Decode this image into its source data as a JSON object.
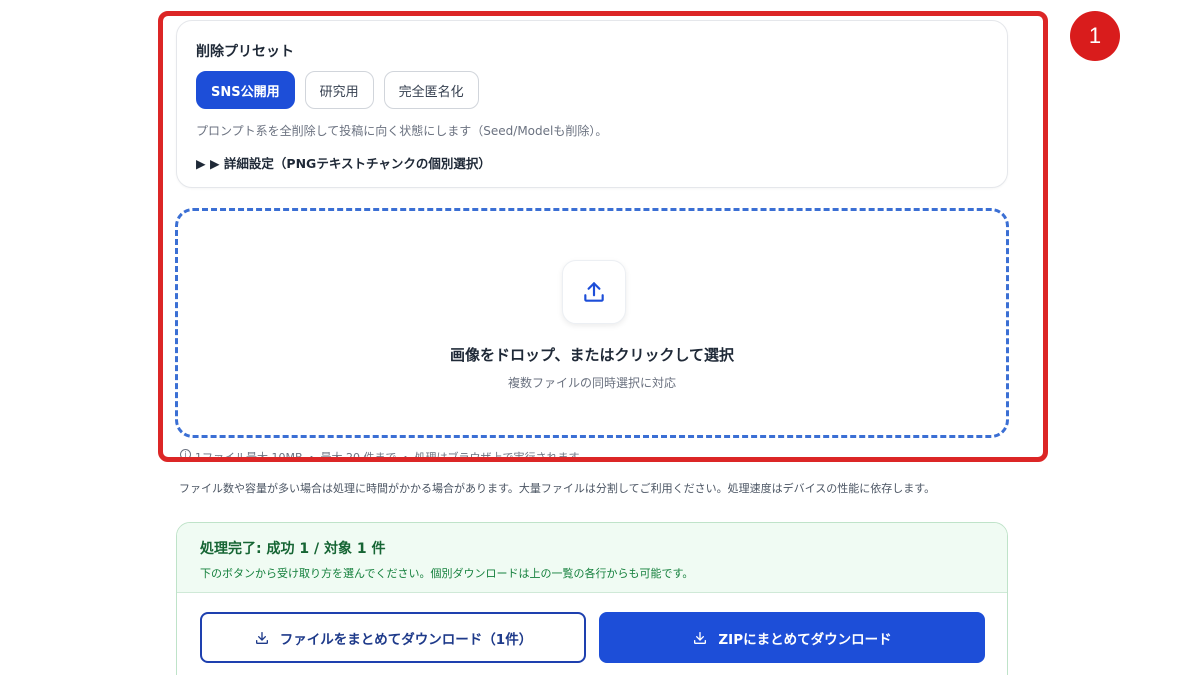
{
  "preset": {
    "title": "削除プリセット",
    "buttons": [
      {
        "label": "SNS公開用",
        "active": true
      },
      {
        "label": "研究用",
        "active": false
      },
      {
        "label": "完全匿名化",
        "active": false
      }
    ],
    "description": "プロンプト系を全削除して投稿に向く状態にします（Seed/Modelも削除）。",
    "detail_toggle": "▶ ▶ 詳細設定（PNGテキストチャンクの個別選択）"
  },
  "dropzone": {
    "icon": "upload-icon",
    "title": "画像をドロップ、またはクリックして選択",
    "subtitle": "複数ファイルの同時選択に対応"
  },
  "notes": {
    "limits": "1ファイル最大 10MB ・ 最大 20 件まで ・ 処理はブラウザ上で実行されます",
    "performance": "ファイル数や容量が多い場合は処理に時間がかかる場合があります。大量ファイルは分割してご利用ください。処理速度はデバイスの性能に依存します。"
  },
  "result": {
    "title": "処理完了: 成功 1 / 対象 1 件",
    "subtitle": "下のボタンから受け取り方を選んでください。個別ダウンロードは上の一覧の各行からも可能です。",
    "download_all_label": "ファイルをまとめてダウンロード（1件）",
    "download_zip_label": "ZIPにまとめてダウンロード"
  },
  "annotation": {
    "step_number": "1",
    "highlight_color": "#dc2626"
  },
  "colors": {
    "accent": "#1d4ed8",
    "success": "#166534"
  }
}
